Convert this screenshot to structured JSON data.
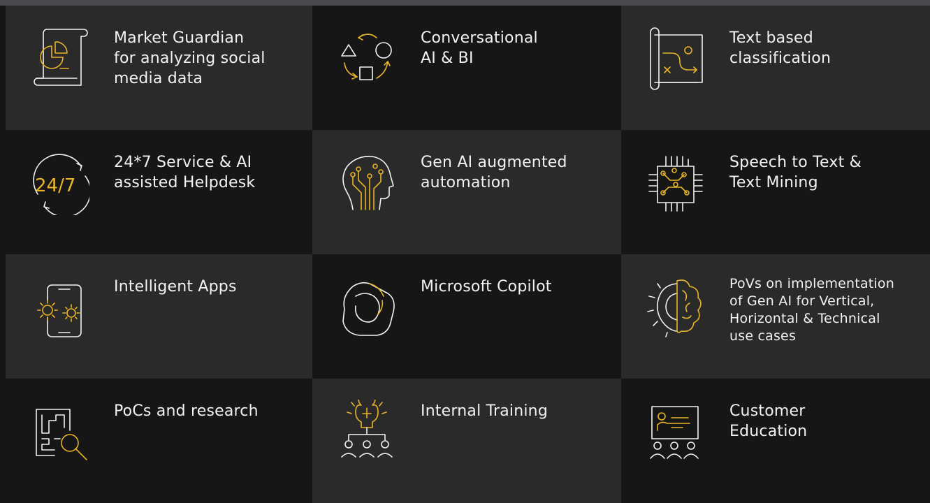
{
  "colors": {
    "background_dark": "#161616",
    "background_light": "#2a2a2a",
    "accent": "#e8b428",
    "text": "#f2f2f2",
    "top_bar": "#4a4a4c"
  },
  "tiles": [
    {
      "label": "Market Guardian\nfor analyzing social\nmedia data",
      "icon": "pie-chart-document-icon"
    },
    {
      "label": "Conversational\nAI & BI",
      "icon": "shapes-cycle-icon"
    },
    {
      "label": "Text based\nclassification",
      "icon": "classification-map-icon"
    },
    {
      "label": "24*7 Service & AI\nassisted Helpdesk",
      "icon": "clock-247-icon",
      "icon_text": "24/7"
    },
    {
      "label": "Gen AI augmented\nautomation",
      "icon": "ai-head-icon"
    },
    {
      "label": "Speech to Text &\nText Mining",
      "icon": "chip-circuit-icon"
    },
    {
      "label": "Intelligent Apps",
      "icon": "phone-gears-icon"
    },
    {
      "label": "Microsoft Copilot",
      "icon": "copilot-logo-icon"
    },
    {
      "label": "PoVs on implementation\nof Gen AI for Vertical,\nHorizontal & Technical\nuse cases",
      "icon": "gear-brain-icon"
    },
    {
      "label": "PoCs and research",
      "icon": "maze-search-icon"
    },
    {
      "label": "Internal Training",
      "icon": "lightbulb-team-icon"
    },
    {
      "label": "Customer\nEducation",
      "icon": "presentation-audience-icon"
    }
  ]
}
